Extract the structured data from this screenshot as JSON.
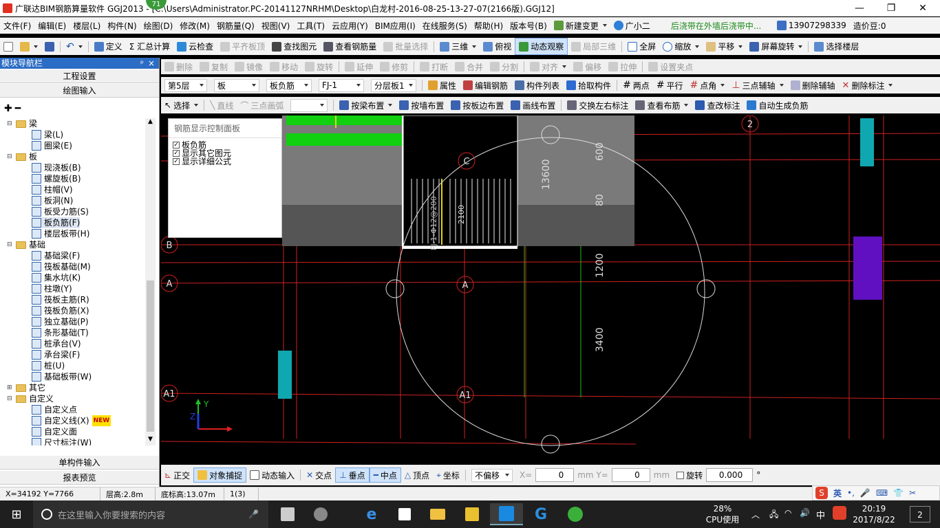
{
  "titlebar": {
    "title": "广联达BIM钢筋算量软件 GGJ2013 - [C:\\Users\\Administrator.PC-20141127NRHM\\Desktop\\白龙村-2016-08-25-13-27-07(2166版).GGJ12]",
    "badge": "71",
    "minimize": "—",
    "restore": "❐",
    "close": "✕"
  },
  "menubar": {
    "items": [
      "文件(F)",
      "编辑(E)",
      "楼层(L)",
      "构件(N)",
      "绘图(D)",
      "修改(M)",
      "钢筋量(Q)",
      "视图(V)",
      "工具(T)",
      "云应用(Y)",
      "BIM应用(I)",
      "在线服务(S)",
      "帮助(H)",
      "版本号(B)",
      "新建变更",
      "广小二"
    ],
    "notice": "后浇带在外墙后浇带中...",
    "phone": "13907298339",
    "cost": "造价豆:0"
  },
  "toolbar1": {
    "items": [
      "定义",
      "Σ 汇总计算",
      "云检查",
      "平齐板顶",
      "查找图元",
      "查看钢筋量",
      "批量选择",
      "三维",
      "俯视",
      "动态观察",
      "局部三维",
      "全屏",
      "缩放",
      "平移",
      "屏幕旋转",
      "选择楼层"
    ]
  },
  "toolbar2": {
    "items": [
      "删除",
      "复制",
      "镜像",
      "移动",
      "旋转",
      "延伸",
      "修剪",
      "打断",
      "合并",
      "分割",
      "对齐",
      "偏移",
      "拉伸",
      "设置夹点"
    ]
  },
  "toolbar3": {
    "floor": "第5层",
    "category": "板",
    "type": "板负筋",
    "element": "FJ-1",
    "layer": "分层板1",
    "items": [
      "属性",
      "编辑钢筋",
      "构件列表",
      "拾取构件",
      "两点",
      "平行",
      "点角",
      "三点辅轴",
      "删除辅轴",
      "删除标注"
    ]
  },
  "toolbar4": {
    "select": "选择",
    "items": [
      "直线",
      "三点画弧",
      "按梁布置",
      "按墙布置",
      "按板边布置",
      "画线布置",
      "交换左右标注",
      "查看布筋",
      "查改标注",
      "自动生成负筋"
    ]
  },
  "nav": {
    "header": "模块导航栏",
    "pin": "ᵖ",
    "close": "×",
    "project_settings": "工程设置",
    "drawing_input": "绘图输入",
    "single_input": "单构件输入",
    "report_preview": "报表预览",
    "tree": [
      {
        "label": "梁",
        "level": 0,
        "folder": true,
        "toggle": "⊟"
      },
      {
        "label": "梁(L)",
        "level": 1
      },
      {
        "label": "圈梁(E)",
        "level": 1
      },
      {
        "label": "板",
        "level": 0,
        "folder": true,
        "toggle": "⊟"
      },
      {
        "label": "现浇板(B)",
        "level": 1
      },
      {
        "label": "螺旋板(B)",
        "level": 1
      },
      {
        "label": "柱帽(V)",
        "level": 1
      },
      {
        "label": "板洞(N)",
        "level": 1
      },
      {
        "label": "板受力筋(S)",
        "level": 1
      },
      {
        "label": "板负筋(F)",
        "level": 1,
        "selected": true
      },
      {
        "label": "楼层板带(H)",
        "level": 1
      },
      {
        "label": "基础",
        "level": 0,
        "folder": true,
        "toggle": "⊟"
      },
      {
        "label": "基础梁(F)",
        "level": 1
      },
      {
        "label": "筏板基础(M)",
        "level": 1
      },
      {
        "label": "集水坑(K)",
        "level": 1
      },
      {
        "label": "柱墩(Y)",
        "level": 1
      },
      {
        "label": "筏板主筋(R)",
        "level": 1
      },
      {
        "label": "筏板负筋(X)",
        "level": 1
      },
      {
        "label": "独立基础(P)",
        "level": 1
      },
      {
        "label": "条形基础(T)",
        "level": 1
      },
      {
        "label": "桩承台(V)",
        "level": 1
      },
      {
        "label": "承台梁(F)",
        "level": 1
      },
      {
        "label": "桩(U)",
        "level": 1
      },
      {
        "label": "基础板带(W)",
        "level": 1
      },
      {
        "label": "其它",
        "level": 0,
        "folder": true,
        "toggle": "⊞"
      },
      {
        "label": "自定义",
        "level": 0,
        "folder": true,
        "toggle": "⊟"
      },
      {
        "label": "自定义点",
        "level": 1
      },
      {
        "label": "自定义线(X)",
        "level": 1,
        "new": "NEW"
      },
      {
        "label": "自定义面",
        "level": 1
      },
      {
        "label": "尺寸标注(W)",
        "level": 1
      }
    ]
  },
  "panel": {
    "title": "钢筋显示控制面板",
    "checks": [
      "板负筋",
      "显示其它图元",
      "显示详细公式"
    ]
  },
  "canvas": {
    "axis_labels": [
      "2",
      "B",
      "A",
      "A",
      "A1",
      "A1",
      "C"
    ],
    "dims": [
      "13600",
      "600",
      "80",
      "1200",
      "3400",
      "2100"
    ],
    "rebar_label": "FJ-1-Φ12@200",
    "axis_x": "X",
    "axis_y": "Y",
    "axis_z": "Z"
  },
  "snapbar": {
    "items": [
      "正交",
      "对象捕捉",
      "动态输入",
      "交点",
      "垂点",
      "中点",
      "顶点",
      "坐标"
    ],
    "offset_mode": "不偏移",
    "x_label": "X=",
    "x_value": "0",
    "y_label": "mm Y=",
    "y_value": "0",
    "mm": "mm",
    "rotate_label": "旋转",
    "rotate_value": "0.000",
    "deg": "°"
  },
  "statusbar": {
    "coords": "X=34192 Y=7766",
    "floor_height": "层高:2.8m",
    "base_elev": "底标高:13.07m",
    "count": "1(3)"
  },
  "taskbar": {
    "search_placeholder": "在这里输入你要搜索的内容",
    "cpu_percent": "28%",
    "cpu_label": "CPU使用",
    "lang": "中",
    "time": "20:19",
    "date": "2017/8/22",
    "notif": "2",
    "ime": "英"
  }
}
